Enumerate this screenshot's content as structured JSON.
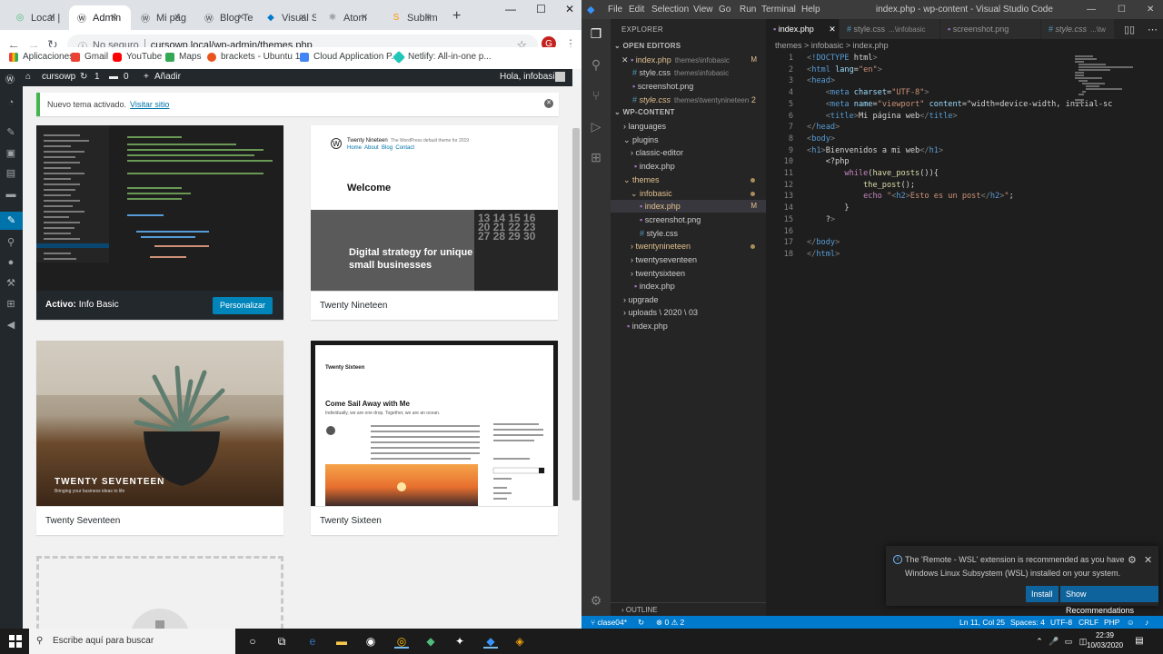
{
  "browser": {
    "tabs": [
      {
        "label": "Local |",
        "icon": "local-icon",
        "color": "#51bb7b"
      },
      {
        "label": "Admin",
        "icon": "wordpress-icon",
        "color": "#23282d",
        "active": true
      },
      {
        "label": "Mi pág",
        "icon": "wordpress-icon",
        "color": "#23282d"
      },
      {
        "label": "Blog Te",
        "icon": "wordpress-icon",
        "color": "#23282d"
      },
      {
        "label": "Visual S",
        "icon": "vscode-icon",
        "color": "#007acc"
      },
      {
        "label": "Atom",
        "icon": "atom-icon",
        "color": "#66595c"
      },
      {
        "label": "Sublim",
        "icon": "sublime-icon",
        "color": "#ff9800"
      }
    ],
    "url_security": "No seguro",
    "url": "cursowp.local/wp-admin/themes.php",
    "profile_initial": "G",
    "bookmarks": [
      {
        "label": "Aplicaciones"
      },
      {
        "label": "Gmail"
      },
      {
        "label": "YouTube"
      },
      {
        "label": "Maps"
      },
      {
        "label": "brackets - Ubuntu 1..."
      },
      {
        "label": "Cloud Application P..."
      },
      {
        "label": "Netlify: All-in-one p..."
      }
    ]
  },
  "wp": {
    "site_name": "cursowp",
    "updates_count": "1",
    "comments_count": "0",
    "add_new": "Añadir",
    "greeting": "Hola, infobasic",
    "notice_text": "Nuevo tema activado.",
    "notice_link": "Visitar sitio",
    "themes": [
      {
        "name": "Info Basic",
        "active_prefix": "Activo:",
        "customize": "Personalizar",
        "active": true
      },
      {
        "name": "Twenty Nineteen",
        "welcome": "Welcome",
        "headline": "Digital strategy for unique small businesses",
        "site": "Twenty Nineteen",
        "tagline": "The WordPress default theme for 2019",
        "nav": "Home  About  Blog  Contact"
      },
      {
        "name": "Twenty Seventeen",
        "overlay_title": "TWENTY SEVENTEEN",
        "overlay_sub": "Bringing your business ideas to life"
      },
      {
        "name": "Twenty Sixteen",
        "site": "Twenty Sixteen",
        "headline": "Come Sail Away with Me",
        "lead": "Individually, we are one drop. Together, we are an ocean."
      }
    ]
  },
  "vscode": {
    "menu": [
      "File",
      "Edit",
      "Selection",
      "View",
      "Go",
      "Run",
      "Terminal",
      "Help"
    ],
    "title": "index.php - wp-content - Visual Studio Code",
    "explorer_title": "EXPLORER",
    "open_editors_title": "OPEN EDITORS",
    "open_editors": [
      {
        "name": "index.php",
        "path": "themes\\infobasic",
        "badge": "M",
        "close": "✕"
      },
      {
        "name": "style.css",
        "path": "themes\\infobasic"
      },
      {
        "name": "screenshot.png",
        "path": ""
      },
      {
        "name": "style.css",
        "path": "themes\\twentynineteen",
        "badge": "2"
      }
    ],
    "workspace_title": "WP-CONTENT",
    "tree": [
      {
        "name": "languages",
        "type": "folder"
      },
      {
        "name": "plugins",
        "type": "folder"
      },
      {
        "name": "classic-editor",
        "type": "folder"
      },
      {
        "name": "index.php",
        "type": "php"
      },
      {
        "name": "themes",
        "type": "folder-open"
      },
      {
        "name": "infobasic",
        "type": "folder-open"
      },
      {
        "name": "index.php",
        "type": "php",
        "badge": "M"
      },
      {
        "name": "screenshot.png",
        "type": "png"
      },
      {
        "name": "style.css",
        "type": "css"
      },
      {
        "name": "twentynineteen",
        "type": "folder"
      },
      {
        "name": "twentyseventeen",
        "type": "folder"
      },
      {
        "name": "twentysixteen",
        "type": "folder"
      },
      {
        "name": "index.php",
        "type": "php"
      },
      {
        "name": "upgrade",
        "type": "folder"
      },
      {
        "name": "uploads \\ 2020 \\ 03",
        "type": "folder"
      },
      {
        "name": "index.php",
        "type": "php"
      }
    ],
    "outline_title": "OUTLINE",
    "editor_tabs": [
      {
        "name": "index.php",
        "path": "",
        "close": "✕"
      },
      {
        "name": "style.css",
        "path": "...\\infobasic"
      },
      {
        "name": "screenshot.png",
        "path": ""
      },
      {
        "name": "style.css",
        "path": "...\\tw"
      }
    ],
    "breadcrumb": "themes > infobasic > index.php",
    "code_lines": [
      "<!DOCTYPE html>",
      "<html lang=\"en\">",
      "<head>",
      "    <meta charset=\"UTF-8\">",
      "    <meta name=\"viewport\" content=\"width=device-width, initial-sc",
      "    <title>Mi página web</title>",
      "</head>",
      "<body>",
      "<h1>Bienvenidos a mi web</h1>",
      "    <?php",
      "        while(have_posts()){",
      "            the_post();",
      "            echo \"<h2>Esto es un post</h2>\";",
      "        }",
      "    ?>",
      "",
      "</body>",
      "</html>"
    ],
    "notification": {
      "line1": "The 'Remote - WSL' extension is recommended as you have",
      "line2": "Windows Linux Subsystem (WSL) installed on your system.",
      "install": "Install",
      "show": "Show Recommendations"
    },
    "status": {
      "branch": "clase04*",
      "problems": "⊗ 0 ⚠ 2",
      "position": "Ln 11, Col 25",
      "spaces": "Spaces: 4",
      "encoding": "UTF-8",
      "eol": "CRLF",
      "language": "PHP"
    }
  },
  "taskbar": {
    "search_placeholder": "Escribe aquí para buscar",
    "time": "22:39",
    "date": "10/03/2020"
  }
}
